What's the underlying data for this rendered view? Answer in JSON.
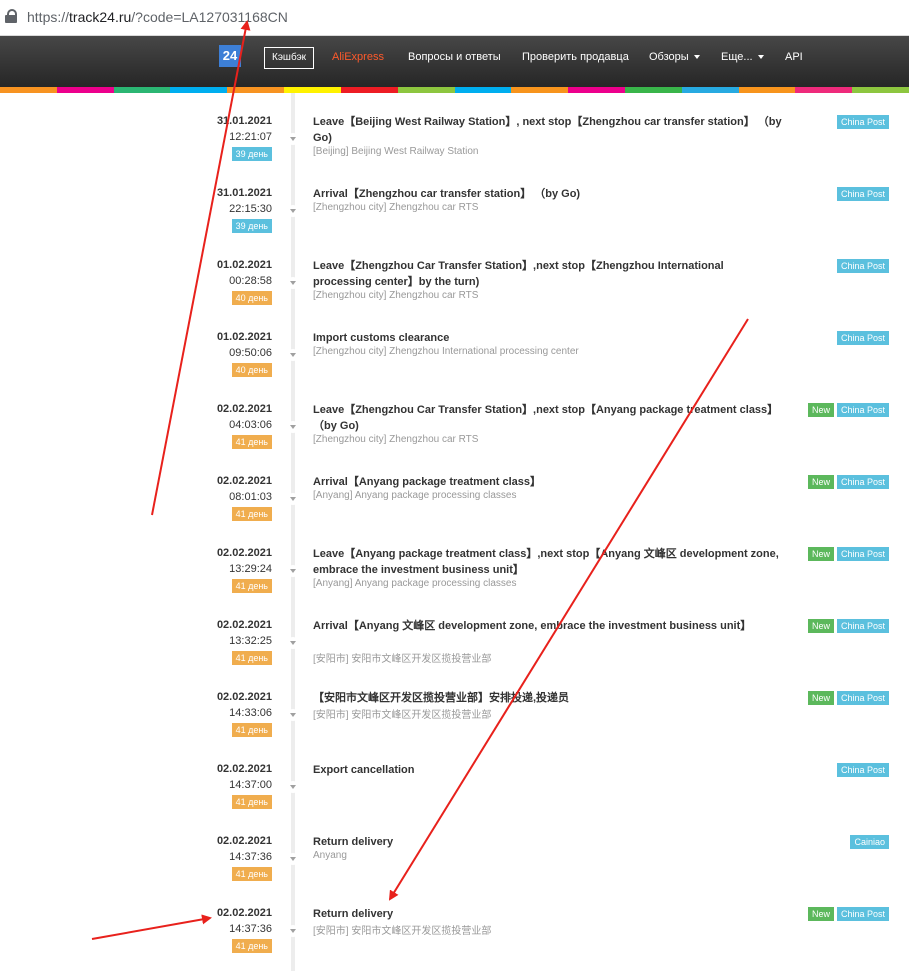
{
  "browser": {
    "url_scheme": "https://",
    "url_host": "track24.ru",
    "url_rest": "/?code=LA127031168CN"
  },
  "nav": {
    "logo": "24",
    "cashback": "Кэшбэк",
    "aliexpress": "AliExpress",
    "faq": "Вопросы и ответы",
    "check_seller": "Проверить продавца",
    "reviews": "Обзоры",
    "more": "Еще...",
    "api": "API"
  },
  "strip_colors": [
    "#f79321",
    "#ec008c",
    "#2bb673",
    "#00aeef",
    "#f79321",
    "#fff200",
    "#ed1c24",
    "#8dc63f",
    "#00aeef",
    "#f7941d",
    "#ec008c",
    "#39b54a",
    "#27aae1",
    "#f7941d",
    "#ee2a7b",
    "#8dc63f"
  ],
  "events": [
    {
      "date": "31.01.2021",
      "time": "12:21:07",
      "days": "39 день",
      "days_color": "blue",
      "title": "Leave【Beijing West Railway Station】, next stop【Zhengzhou car transfer station】 （by Go)",
      "place": "[Beijing] Beijing West Railway Station",
      "new": false,
      "source": "China Post"
    },
    {
      "date": "31.01.2021",
      "time": "22:15:30",
      "days": "39 день",
      "days_color": "blue",
      "title": "Arrival【Zhengzhou car transfer station】 （by Go)",
      "place": "[Zhengzhou city] Zhengzhou car RTS",
      "new": false,
      "source": "China Post"
    },
    {
      "date": "01.02.2021",
      "time": "00:28:58",
      "days": "40 день",
      "days_color": "orange",
      "title": "Leave【Zhengzhou Car Transfer Station】,next stop【Zhengzhou International processing center】by the turn)",
      "place": "[Zhengzhou city] Zhengzhou car RTS",
      "new": false,
      "source": "China Post"
    },
    {
      "date": "01.02.2021",
      "time": "09:50:06",
      "days": "40 день",
      "days_color": "orange",
      "title": "Import customs clearance",
      "place": "[Zhengzhou city] Zhengzhou International processing center",
      "new": false,
      "source": "China Post"
    },
    {
      "date": "02.02.2021",
      "time": "04:03:06",
      "days": "41 день",
      "days_color": "orange",
      "title": "Leave【Zhengzhou Car Transfer Station】,next stop【Anyang package treatment class】 （by Go)",
      "place": "[Zhengzhou city] Zhengzhou car RTS",
      "new": true,
      "source": "China Post"
    },
    {
      "date": "02.02.2021",
      "time": "08:01:03",
      "days": "41 день",
      "days_color": "orange",
      "title": "Arrival【Anyang package treatment class】",
      "place": "[Anyang] Anyang package processing classes",
      "new": true,
      "source": "China Post"
    },
    {
      "date": "02.02.2021",
      "time": "13:29:24",
      "days": "41 день",
      "days_color": "orange",
      "title": "Leave【Anyang package treatment class】,next stop【Anyang 文峰区 development zone, embrace the investment business unit】",
      "place": "[Anyang] Anyang package processing classes",
      "new": true,
      "source": "China Post"
    },
    {
      "date": "02.02.2021",
      "time": "13:32:25",
      "days": "41 день",
      "days_color": "orange",
      "title": "Arrival【Anyang 文峰区 development zone, embrace the investment business unit】",
      "place": "[安阳市] 安阳市文峰区开发区揽投营业部",
      "new": true,
      "source": "China Post"
    },
    {
      "date": "02.02.2021",
      "time": "14:33:06",
      "days": "41 день",
      "days_color": "orange",
      "title": "【安阳市文峰区开发区揽投营业部】安排投递,投递员",
      "place": "[安阳市] 安阳市文峰区开发区揽投营业部",
      "new": true,
      "source": "China Post"
    },
    {
      "date": "02.02.2021",
      "time": "14:37:00",
      "days": "41 день",
      "days_color": "orange",
      "title": "Export cancellation",
      "place": "",
      "new": false,
      "source": "China Post"
    },
    {
      "date": "02.02.2021",
      "time": "14:37:36",
      "days": "41 день",
      "days_color": "orange",
      "title": "Return delivery",
      "place": "Anyang",
      "new": false,
      "source": "Cainiao"
    },
    {
      "date": "02.02.2021",
      "time": "14:37:36",
      "days": "41 день",
      "days_color": "orange",
      "title": "Return delivery",
      "place": "[安阳市] 安阳市文峰区开发区揽投营业部",
      "new": true,
      "source": "China Post"
    }
  ],
  "new_label": "New",
  "annotation_color": "#e8211c"
}
